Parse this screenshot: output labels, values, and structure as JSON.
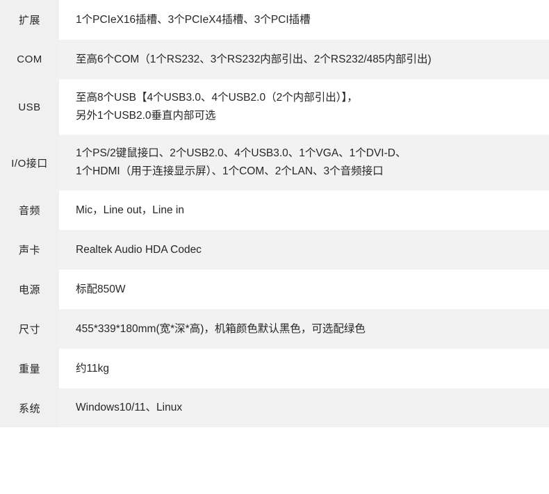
{
  "spec_table": {
    "rows": [
      {
        "label": "扩展",
        "lines": [
          "1个PCIeX16插槽、3个PCIeX4插槽、3个PCI插槽"
        ],
        "shaded": false
      },
      {
        "label": "COM",
        "lines": [
          "至高6个COM（1个RS232、3个RS232内部引出、2个RS232/485内部引出)"
        ],
        "shaded": true
      },
      {
        "label": "USB",
        "lines": [
          "至高8个USB【4个USB3.0、4个USB2.0（2个内部引出）】，",
          "另外1个USB2.0垂直内部可选"
        ],
        "shaded": false
      },
      {
        "label": "I/O接口",
        "lines": [
          "1个PS/2键鼠接口、2个USB2.0、4个USB3.0、1个VGA、1个DVI-D、",
          "1个HDMI（用于连接显示屏）、1个COM、2个LAN、3个音频接口"
        ],
        "shaded": true
      },
      {
        "label": "音频",
        "lines": [
          "Mic，Line out，Line in"
        ],
        "shaded": false
      },
      {
        "label": "声卡",
        "lines": [
          "Realtek Audio HDA Codec"
        ],
        "shaded": true
      },
      {
        "label": "电源",
        "lines": [
          "标配850W"
        ],
        "shaded": false
      },
      {
        "label": "尺寸",
        "lines": [
          "455*339*180mm(宽*深*高)，机箱颜色默认黑色，可选配绿色"
        ],
        "shaded": true
      },
      {
        "label": "重量",
        "lines": [
          "约11kg"
        ],
        "shaded": false
      },
      {
        "label": "系统",
        "lines": [
          "Windows10/11、Linux"
        ],
        "shaded": true
      }
    ]
  },
  "colors": {
    "label_background": "#f0f0f0",
    "row_shaded_background": "#f2f2f2",
    "row_plain_background": "#ffffff",
    "text": "#262626",
    "page_background": "#ffffff"
  }
}
